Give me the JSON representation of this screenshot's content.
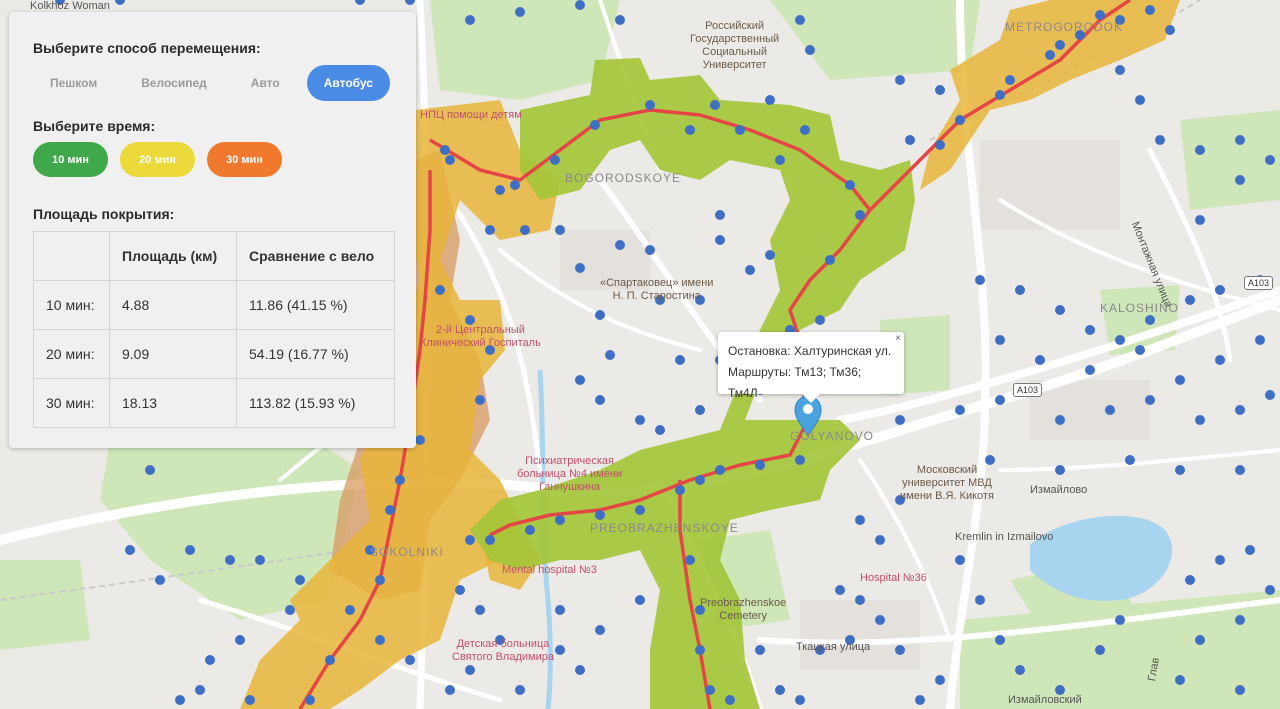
{
  "panel": {
    "mode_title": "Выберите способ перемещения:",
    "modes": [
      "Пешком",
      "Велосипед",
      "Авто",
      "Автобус"
    ],
    "active_mode": "Автобус",
    "time_title": "Выберите время:",
    "times": [
      {
        "label": "10 мин",
        "color": "#3fa84a"
      },
      {
        "label": "20 мин",
        "color": "#ecd93a"
      },
      {
        "label": "30 мин",
        "color": "#f0792e"
      }
    ],
    "coverage_title": "Площадь покрытия:",
    "table": {
      "headers": [
        "",
        "Площадь (км)",
        "Сравнение с вело"
      ],
      "rows": [
        [
          "10 мин:",
          "4.88",
          "11.86 (41.15 %)"
        ],
        [
          "20 мин:",
          "9.09",
          "54.19 (16.77 %)"
        ],
        [
          "30 мин:",
          "18.13",
          "113.82 (15.93 %)"
        ]
      ]
    }
  },
  "popup": {
    "stop": "Остановка: Халтуринская ул.",
    "routes": "Маршруты: Тм13; Тм36; Тм4Л",
    "close": "×"
  },
  "colors": {
    "zone_10": "#a4c63a",
    "zone_20": "#e8b53a",
    "zone_30": "#d99a62",
    "route": "#e64545",
    "stop": "#3f6fc4",
    "marker": "#4aa3df"
  },
  "map_labels": {
    "kolkhoz": "Kolkhoz Woman",
    "rsu": "Российский\nГосударственный\nСоциальный\nУниверситет",
    "metrogorodok": "METROGORODOK",
    "npc": "НПЦ помощи детям",
    "bogorodskoye": "BOGORODSKOYE",
    "spartakovets": "«Спартаковец» имени\nН. П. Старостина",
    "montazhnaya": "Монтажная улица",
    "a103_1": "A103",
    "kaloshino": "KALOSHINO",
    "a103_2": "A103",
    "hosp2": "2-й Центральный\nКлинический Госпиталь",
    "sokolniki": "SOKOLNIKI",
    "psych": "Психиатрическая\nбольница №4 имени\nГаннушкина",
    "preobrazhenskoye": "PREOBRAZHENSKOYE",
    "golyanovo": "GOLYANOVO",
    "mvd": "Московский\nуниверситет МВД\nимени В.Я. Кикотя",
    "izmailovo": "Измайлово",
    "kremlin": "Kremlin in Izmailovo",
    "mental": "Mental hospital №3",
    "hosp36": "Hospital №36",
    "cemetery": "Preobrazhenskoe\nCemetery",
    "detskaya": "Детская больница\nСвятого Владимира",
    "tkatskaya": "Ткацкая улица",
    "izmailovsky": "Измайловский",
    "glav": "Глав"
  }
}
